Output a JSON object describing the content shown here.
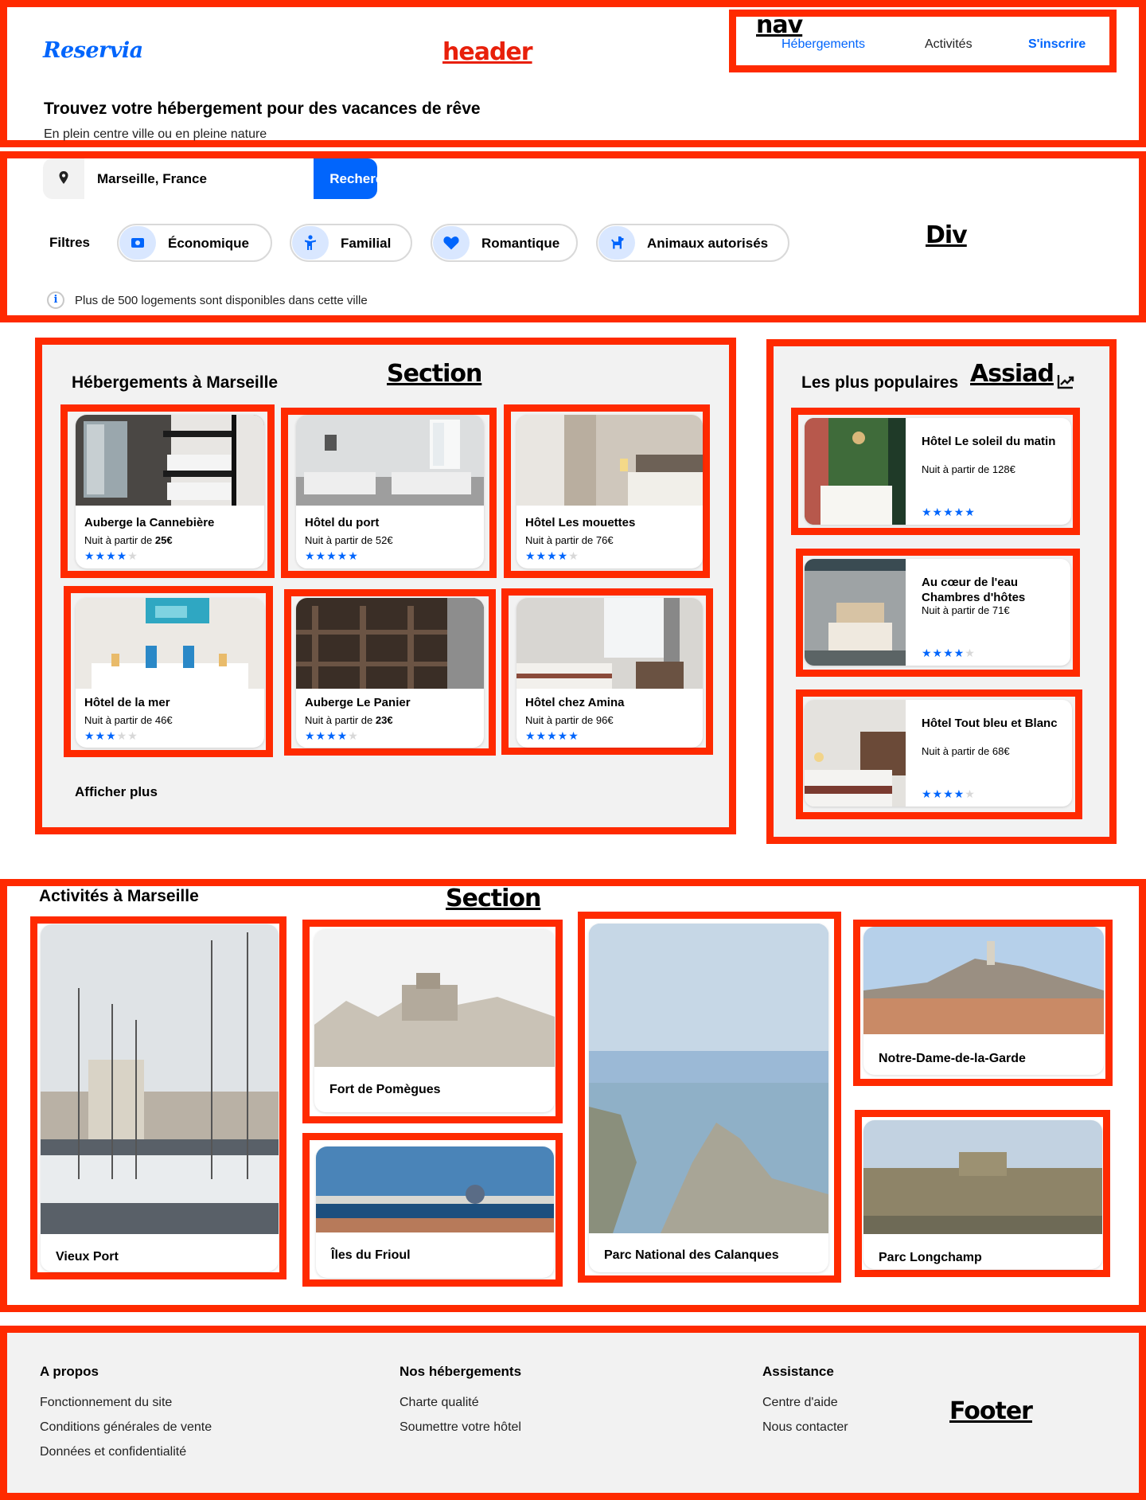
{
  "annotations": {
    "header": "header",
    "nav": "nav",
    "search": "Div",
    "listings": "Section",
    "aside": "Assiad",
    "activities": "Section",
    "footer": "Footer"
  },
  "header": {
    "logo": "Reservia",
    "nav": [
      "Hébergements",
      "Activités",
      "S'inscrire"
    ],
    "title": "Trouvez votre hébergement pour des vacances de rêve",
    "subtitle": "En plein centre ville ou en pleine nature"
  },
  "search": {
    "value": "Marseille, France",
    "button": "Rechercher",
    "filters_label": "Filtres",
    "filters": [
      "Économique",
      "Familial",
      "Romantique",
      "Animaux autorisés"
    ],
    "info": "Plus de 500 logements sont disponibles dans cette ville"
  },
  "listings": {
    "title": "Hébergements à Marseille",
    "price_prefix": "Nuit à partir de",
    "items": [
      {
        "name": "Auberge la Cannebière",
        "price": "25€",
        "price_bold": true,
        "rating": 4
      },
      {
        "name": "Hôtel du port",
        "price": "52€",
        "price_bold": false,
        "rating": 5
      },
      {
        "name": "Hôtel Les mouettes",
        "price": "76€",
        "price_bold": false,
        "rating": 4
      },
      {
        "name": "Hôtel de la mer",
        "price": "46€",
        "price_bold": false,
        "rating": 3
      },
      {
        "name": "Auberge Le Panier",
        "price": "23€",
        "price_bold": true,
        "rating": 4
      },
      {
        "name": "Hôtel chez Amina",
        "price": "96€",
        "price_bold": false,
        "rating": 5
      }
    ],
    "show_more": "Afficher plus"
  },
  "popular": {
    "title": "Les plus populaires",
    "price_prefix": "Nuit à partir de",
    "items": [
      {
        "name": "Hôtel Le soleil du matin",
        "price": "128€",
        "rating": 5
      },
      {
        "name": "Au cœur de l'eau Chambres d'hôtes",
        "price": "71€",
        "rating": 4
      },
      {
        "name": "Hôtel Tout bleu et Blanc",
        "price": "68€",
        "rating": 4
      }
    ]
  },
  "activities": {
    "title": "Activités à Marseille",
    "items": [
      {
        "name": "Vieux Port"
      },
      {
        "name": "Fort de Pomègues"
      },
      {
        "name": "Îles du Frioul"
      },
      {
        "name": "Parc National des Calanques"
      },
      {
        "name": "Notre-Dame-de-la-Garde"
      },
      {
        "name": "Parc Longchamp"
      }
    ]
  },
  "footer": {
    "columns": [
      {
        "title": "A propos",
        "links": [
          "Fonctionnement du site",
          "Conditions générales de vente",
          "Données et confidentialité"
        ]
      },
      {
        "title": "Nos hébergements",
        "links": [
          "Charte qualité",
          "Soumettre votre hôtel"
        ]
      },
      {
        "title": "Assistance",
        "links": [
          "Centre d'aide",
          "Nous contacter"
        ]
      }
    ]
  },
  "colors": {
    "accent": "#0165fc",
    "annotation_box": "#ff2a00",
    "panel_bg": "#f2f2f2"
  }
}
